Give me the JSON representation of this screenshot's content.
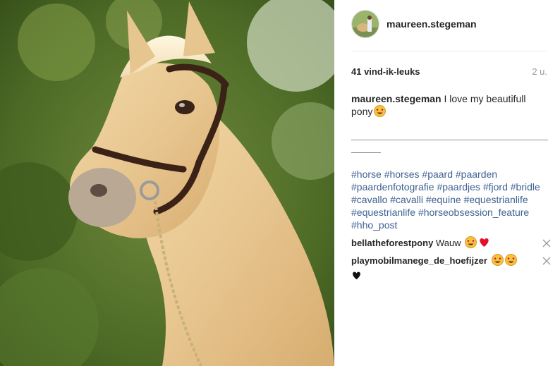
{
  "post": {
    "photo_label": "horse photo",
    "username": "maureen.stegeman",
    "likes": "41 vind-ik-leuks",
    "time": "2 u.",
    "caption_user": "maureen.stegeman",
    "caption_text": "I love my beautifull pony",
    "hashtags": [
      "#horse",
      "#horses",
      "#paard",
      "#paarden",
      "#paardenfotografie",
      "#paardjes",
      "#fjord",
      "#bridle",
      "#cavallo",
      "#cavalli",
      "#equine",
      "#equestrianlife",
      "#equestrianlife",
      "#horseobsession_feature",
      "#hho_post"
    ]
  },
  "comments": [
    {
      "user": "bellatheforestpony",
      "text": "Wauw",
      "emojis": [
        "heart-eyes-emoji",
        "red-heart-emoji"
      ]
    },
    {
      "user": "playmobilmanege_de_hoefijzer",
      "text": "",
      "emojis": [
        "heart-eyes-emoji",
        "heart-eyes-emoji",
        "black-heart-emoji"
      ]
    }
  ],
  "colors": {
    "hashtag": "#3d6192",
    "text": "#262626",
    "muted": "#999999",
    "heart_red": "#e0102b"
  }
}
